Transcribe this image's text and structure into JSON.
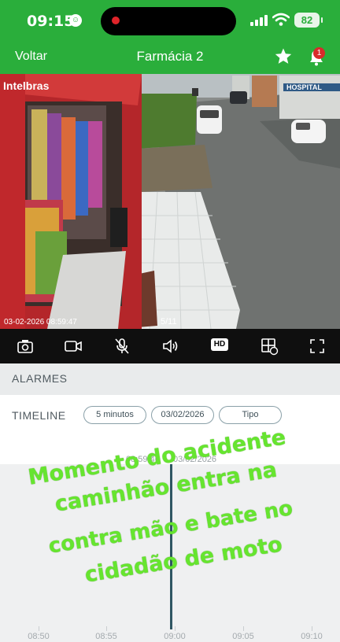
{
  "status_bar": {
    "time": "09:15",
    "battery": "82"
  },
  "header": {
    "back_label": "Voltar",
    "title": "Farmácia 2",
    "notification_count": "1"
  },
  "camera": {
    "brand": "Intelbras",
    "timestamp": "03-02-2026 08:59:47",
    "page": "5/11",
    "sign_text": "HOSPITAL"
  },
  "toolbar": {
    "icons": [
      "camera-icon",
      "video-icon",
      "mic-muted-icon",
      "speaker-icon",
      "hd-icon",
      "grid-icon",
      "fullscreen-icon"
    ],
    "hd_label": "HD"
  },
  "tabs": {
    "alarms_label": "ALARMES"
  },
  "timeline": {
    "label": "TIMELINE",
    "interval": "5 minutos",
    "date": "03/02/2026",
    "third_pill": "Tipo",
    "current_time": "08:59:46",
    "current_date": "03/02/2026",
    "ticks": [
      "08:50",
      "08:55",
      "09:00",
      "09:05",
      "09:10"
    ]
  },
  "caption": {
    "line1": "Momento do acidente",
    "line2": "caminhão entra na",
    "line3": "contra mão e bate no",
    "line4": "cidadão de moto"
  },
  "colors": {
    "header_green": "#2aae3b",
    "caption_green": "#66e52f",
    "toolbar_bg": "#0f0f0f",
    "needle": "#2f5663"
  }
}
